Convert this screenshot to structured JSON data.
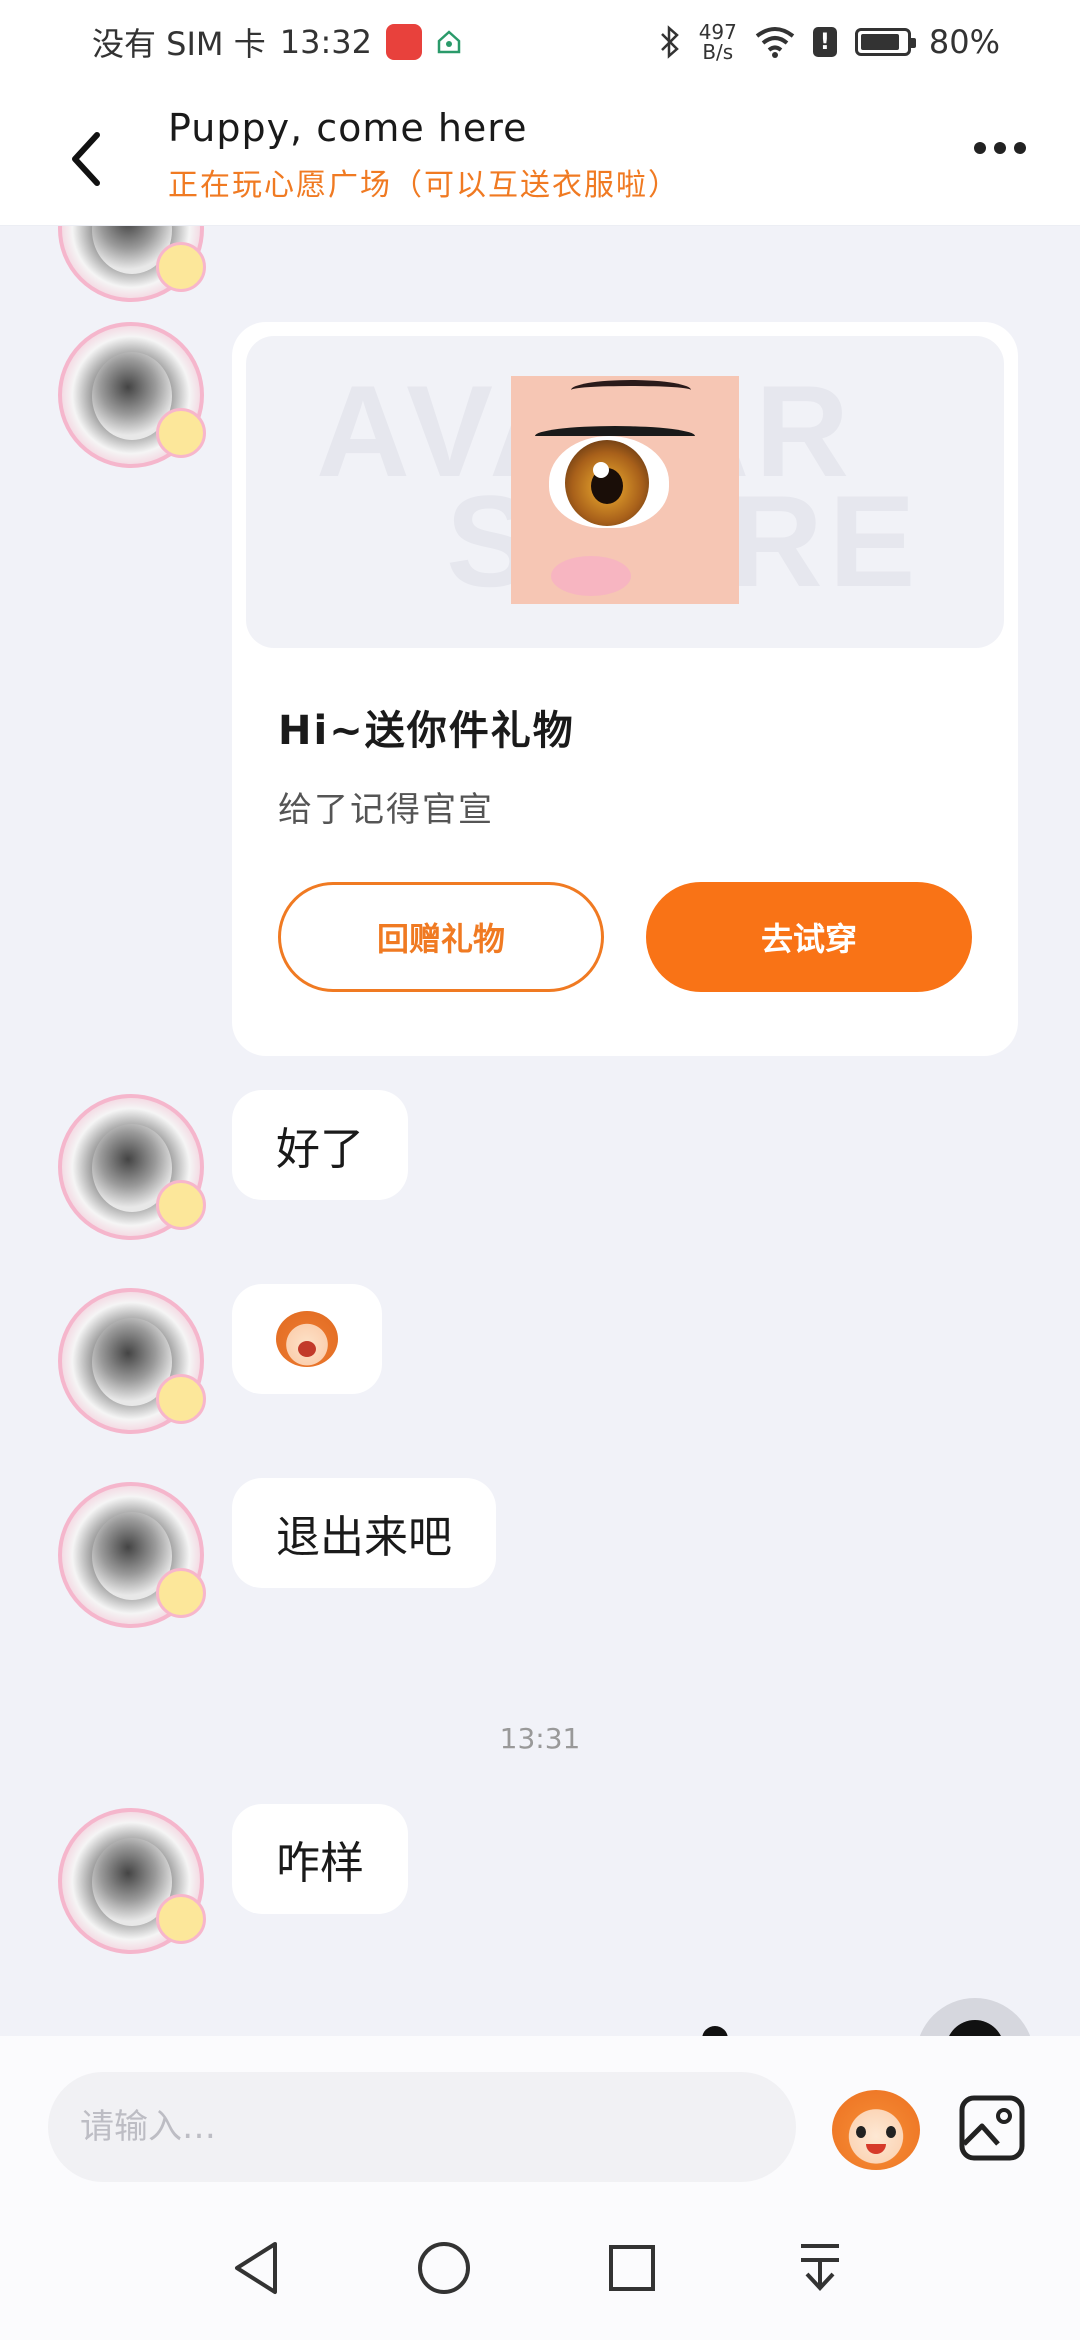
{
  "status_bar": {
    "carrier": "没有 SIM 卡",
    "time": "13:32",
    "net_speed_value": "497",
    "net_speed_unit": "B/s",
    "battery": "80%"
  },
  "header": {
    "title": "Puppy, come here",
    "subtitle": "正在玩心愿广场（可以互送衣服啦）"
  },
  "gift_card": {
    "watermark_line1": "AVATAR",
    "watermark_line2": "STORE",
    "title": "Hi~送你件礼物",
    "description": "给了记得官宣",
    "return_gift_label": "回赠礼物",
    "try_on_label": "去试穿"
  },
  "messages": [
    {
      "text": "好了"
    },
    {
      "text": ""
    },
    {
      "text": "退出来吧"
    },
    {
      "text": "咋样"
    }
  ],
  "timestamp": "13:31",
  "input": {
    "placeholder": "请输入…"
  },
  "colors": {
    "accent": "#f97316",
    "subtitle": "#f07a22",
    "background": "#f1f2f8"
  },
  "icons": {
    "back": "chevron-left-icon",
    "more": "more-dots-icon",
    "emoji": "emoji-icon",
    "image": "image-icon",
    "nav_back": "triangle-back-icon",
    "nav_home": "circle-home-icon",
    "nav_recents": "square-recents-icon",
    "nav_notifications": "notifications-down-icon"
  }
}
